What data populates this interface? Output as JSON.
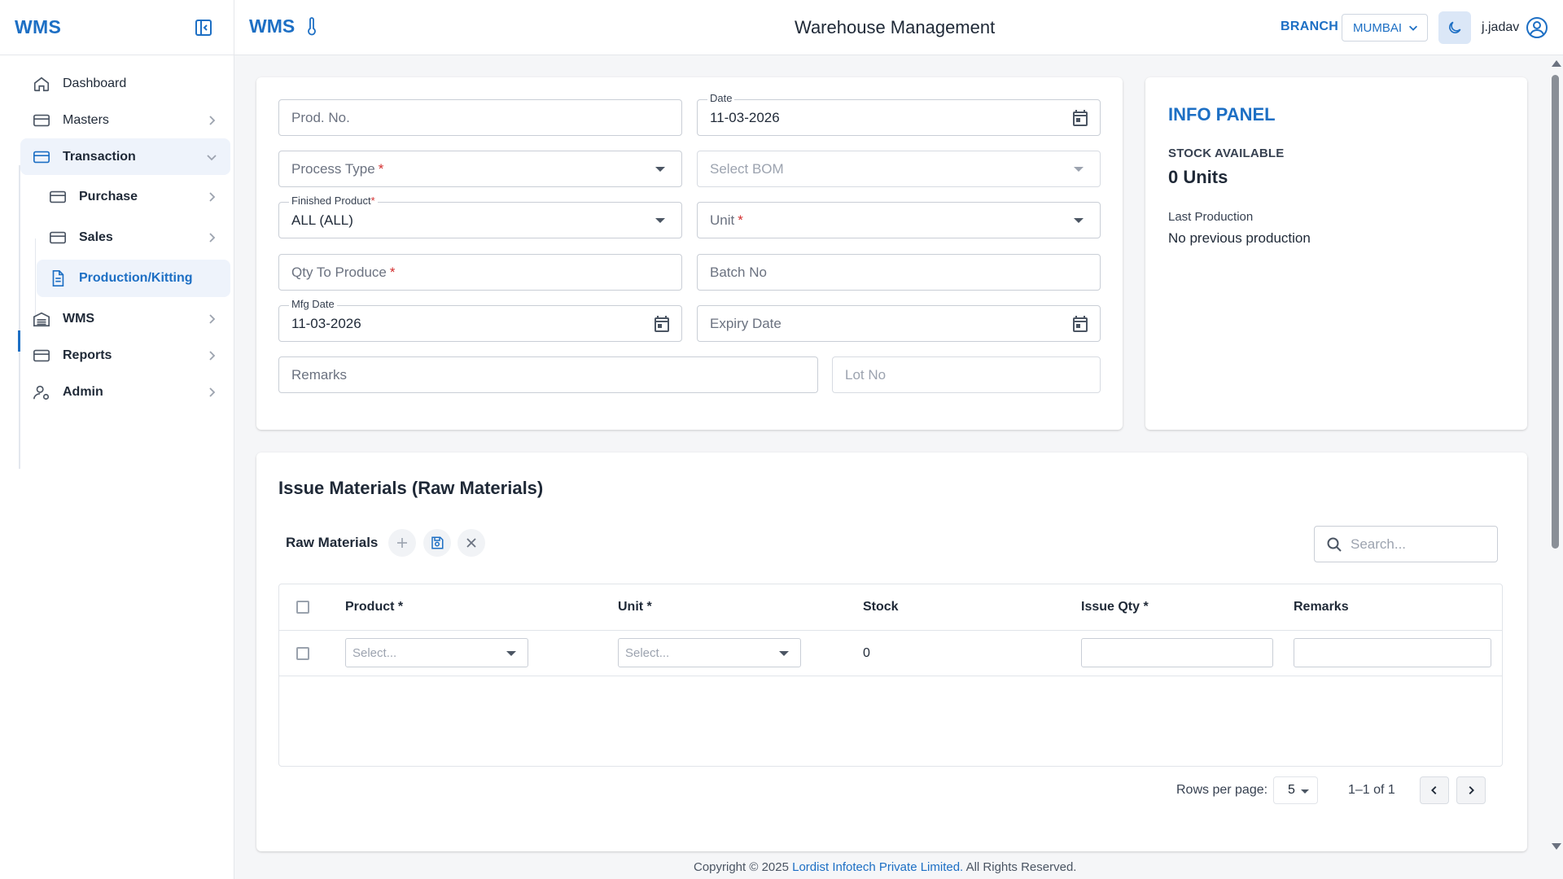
{
  "sidebar": {
    "logo": "WMS",
    "items": [
      {
        "label": "Dashboard"
      },
      {
        "label": "Masters"
      },
      {
        "label": "Transaction"
      },
      {
        "label": "Purchase"
      },
      {
        "label": "Sales"
      },
      {
        "label": "Production/Kitting"
      },
      {
        "label": "WMS"
      },
      {
        "label": "Reports"
      },
      {
        "label": "Admin"
      }
    ]
  },
  "topbar": {
    "brand": "WMS",
    "title": "Warehouse Management",
    "branch_label": "BRANCH",
    "branch_value": "MUMBAI",
    "username": "j.jadav"
  },
  "form": {
    "prod_no_placeholder": "Prod. No.",
    "date_label": "Date",
    "date_value": "11-03-2026",
    "process_type_placeholder": "Process Type",
    "select_bom_placeholder": "Select BOM",
    "finished_product_label": "Finished Product",
    "finished_product_value": "ALL (ALL)",
    "unit_placeholder": "Unit",
    "qty_placeholder": "Qty To Produce",
    "batch_placeholder": "Batch No",
    "mfg_label": "Mfg Date",
    "mfg_value": "11-03-2026",
    "expiry_placeholder": "Expiry Date",
    "remarks_placeholder": "Remarks",
    "lot_placeholder": "Lot No",
    "required_mark": "*"
  },
  "info_panel": {
    "title": "INFO PANEL",
    "stock_label": "STOCK AVAILABLE",
    "stock_value": "0 Units",
    "last_label": "Last Production",
    "last_value": "No previous production"
  },
  "issue": {
    "title": "Issue Materials (Raw Materials)",
    "toolbar_label": "Raw Materials",
    "search_placeholder": "Search...",
    "columns": [
      "Product *",
      "Unit *",
      "Stock",
      "Issue Qty *",
      "Remarks"
    ],
    "row": {
      "product_placeholder": "Select...",
      "unit_placeholder": "Select...",
      "stock": "0"
    },
    "pagination": {
      "rows_label": "Rows per page:",
      "rows_value": "5",
      "range": "1–1 of 1"
    }
  },
  "footer": {
    "prefix": "Copyright © 2025 ",
    "company": "Lordist Infotech Private Limited.",
    "suffix": " All Rights Reserved."
  },
  "colors": {
    "accent": "#1d6fc4",
    "active_bg": "#eef3fb",
    "required": "#d32f2f"
  }
}
